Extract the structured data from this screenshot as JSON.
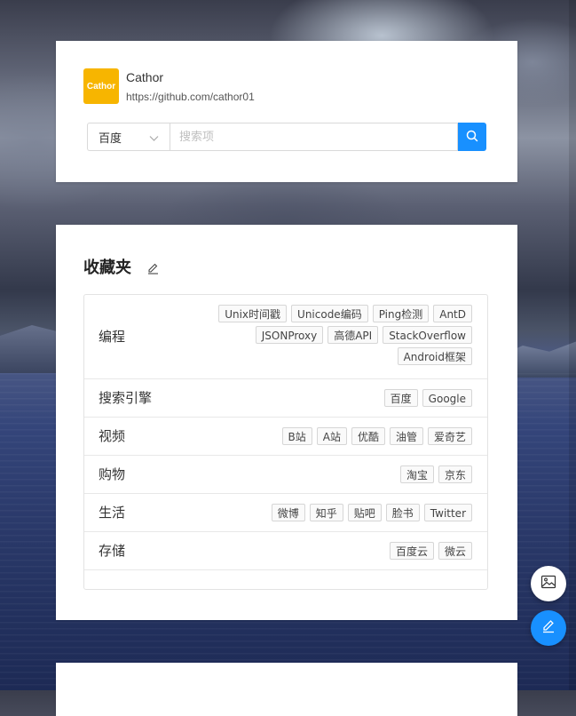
{
  "profile": {
    "avatar_text": "Cathor",
    "name": "Cathor",
    "url": "https://github.com/cathor01"
  },
  "search": {
    "engine_selected": "百度",
    "placeholder": "搜索项",
    "value": ""
  },
  "favorites": {
    "title": "收藏夹",
    "rows": [
      {
        "label": "编程",
        "tags": [
          "Unix时间戳",
          "Unicode编码",
          "Ping检测",
          "AntD",
          "JSONProxy",
          "高德API",
          "StackOverflow",
          "Android框架"
        ]
      },
      {
        "label": "搜索引擎",
        "tags": [
          "百度",
          "Google"
        ]
      },
      {
        "label": "视频",
        "tags": [
          "B站",
          "A站",
          "优酷",
          "油管",
          "爱奇艺"
        ]
      },
      {
        "label": "购物",
        "tags": [
          "淘宝",
          "京东"
        ]
      },
      {
        "label": "生活",
        "tags": [
          "微博",
          "知乎",
          "贴吧",
          "脸书",
          "Twitter"
        ]
      },
      {
        "label": "存储",
        "tags": [
          "百度云",
          "微云"
        ]
      }
    ]
  },
  "colors": {
    "accent": "#1890ff",
    "avatar_bg": "#f7b500"
  },
  "icons": {
    "search": "search-icon",
    "chevron": "chevron-down-icon",
    "edit": "pencil-icon",
    "image": "image-icon"
  }
}
